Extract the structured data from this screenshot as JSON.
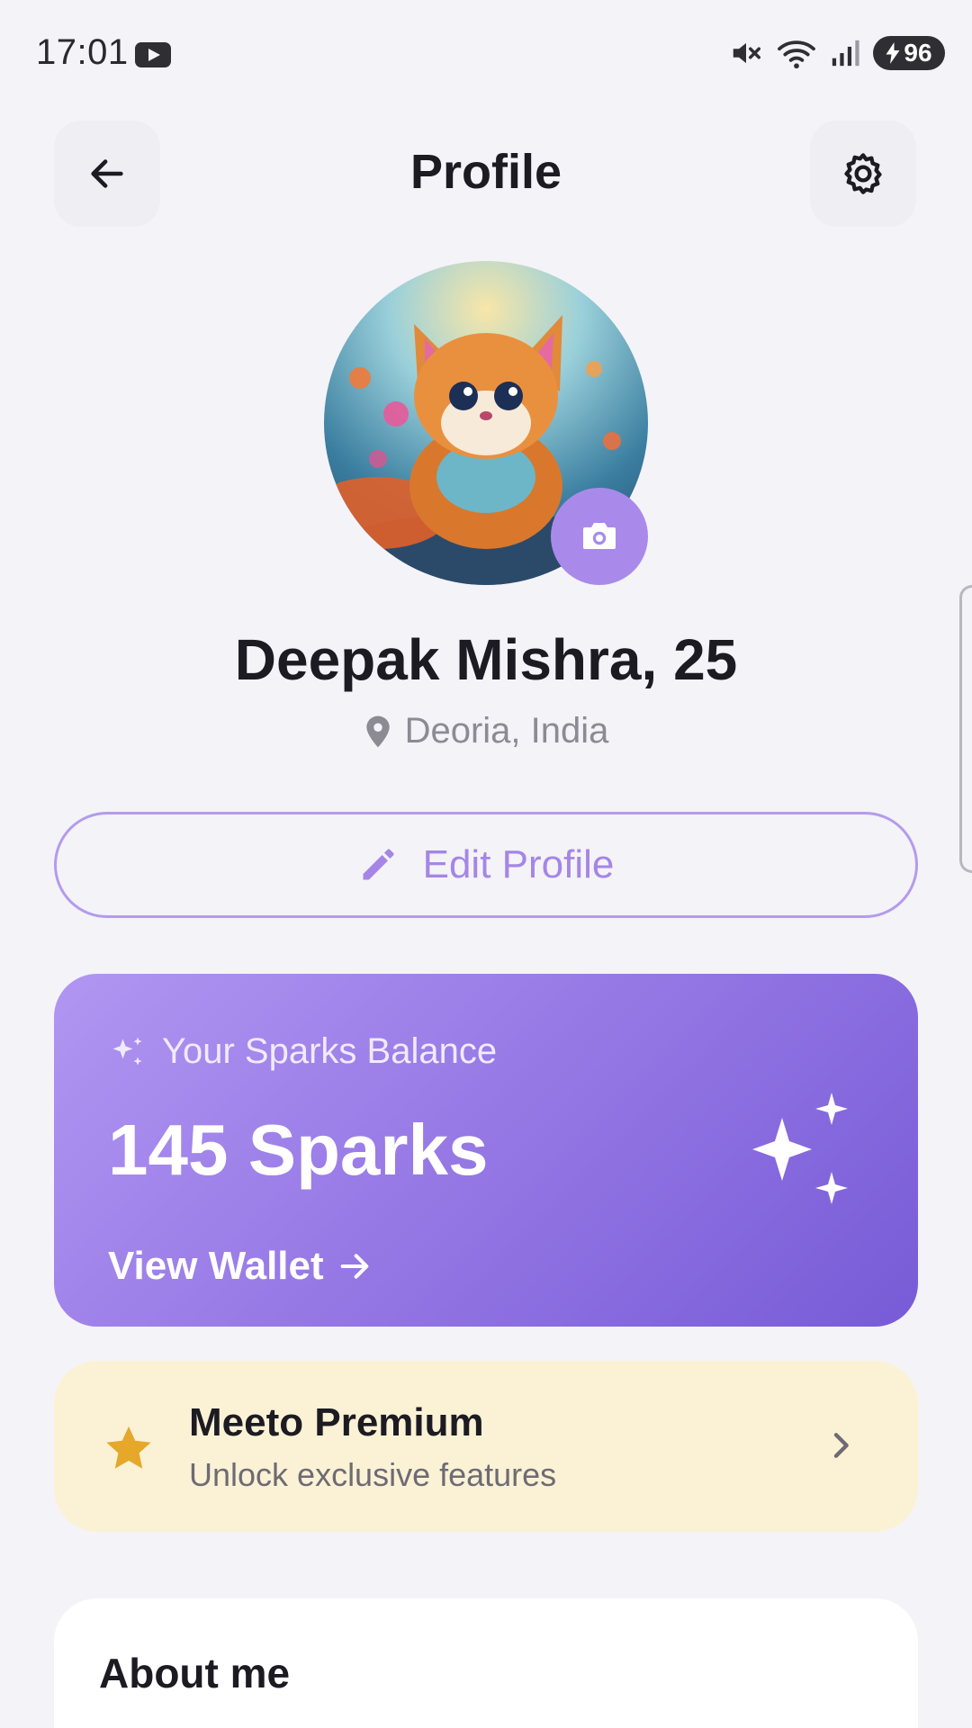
{
  "status_bar": {
    "time": "17:01",
    "battery": "96",
    "icons": [
      "youtube-icon",
      "mute-icon",
      "wifi-icon",
      "signal-icon",
      "battery-icon"
    ]
  },
  "header": {
    "title": "Profile",
    "back_icon": "arrow-left-icon",
    "settings_icon": "gear-icon"
  },
  "profile": {
    "name": "Deepak Mishra, 25",
    "location": "Deoria, India",
    "camera_icon": "camera-icon"
  },
  "edit_profile": {
    "label": "Edit Profile",
    "icon": "pencil-icon"
  },
  "sparks": {
    "label": "Your Sparks Balance",
    "amount": "145 Sparks",
    "wallet_link": "View Wallet"
  },
  "premium": {
    "title": "Meeto Premium",
    "subtitle": "Unlock exclusive features"
  },
  "about": {
    "title": "About me"
  },
  "colors": {
    "accent": "#a98aea",
    "background": "#f4f3f8",
    "premium_bg": "#fbf2d6",
    "star": "#e5a82a"
  }
}
